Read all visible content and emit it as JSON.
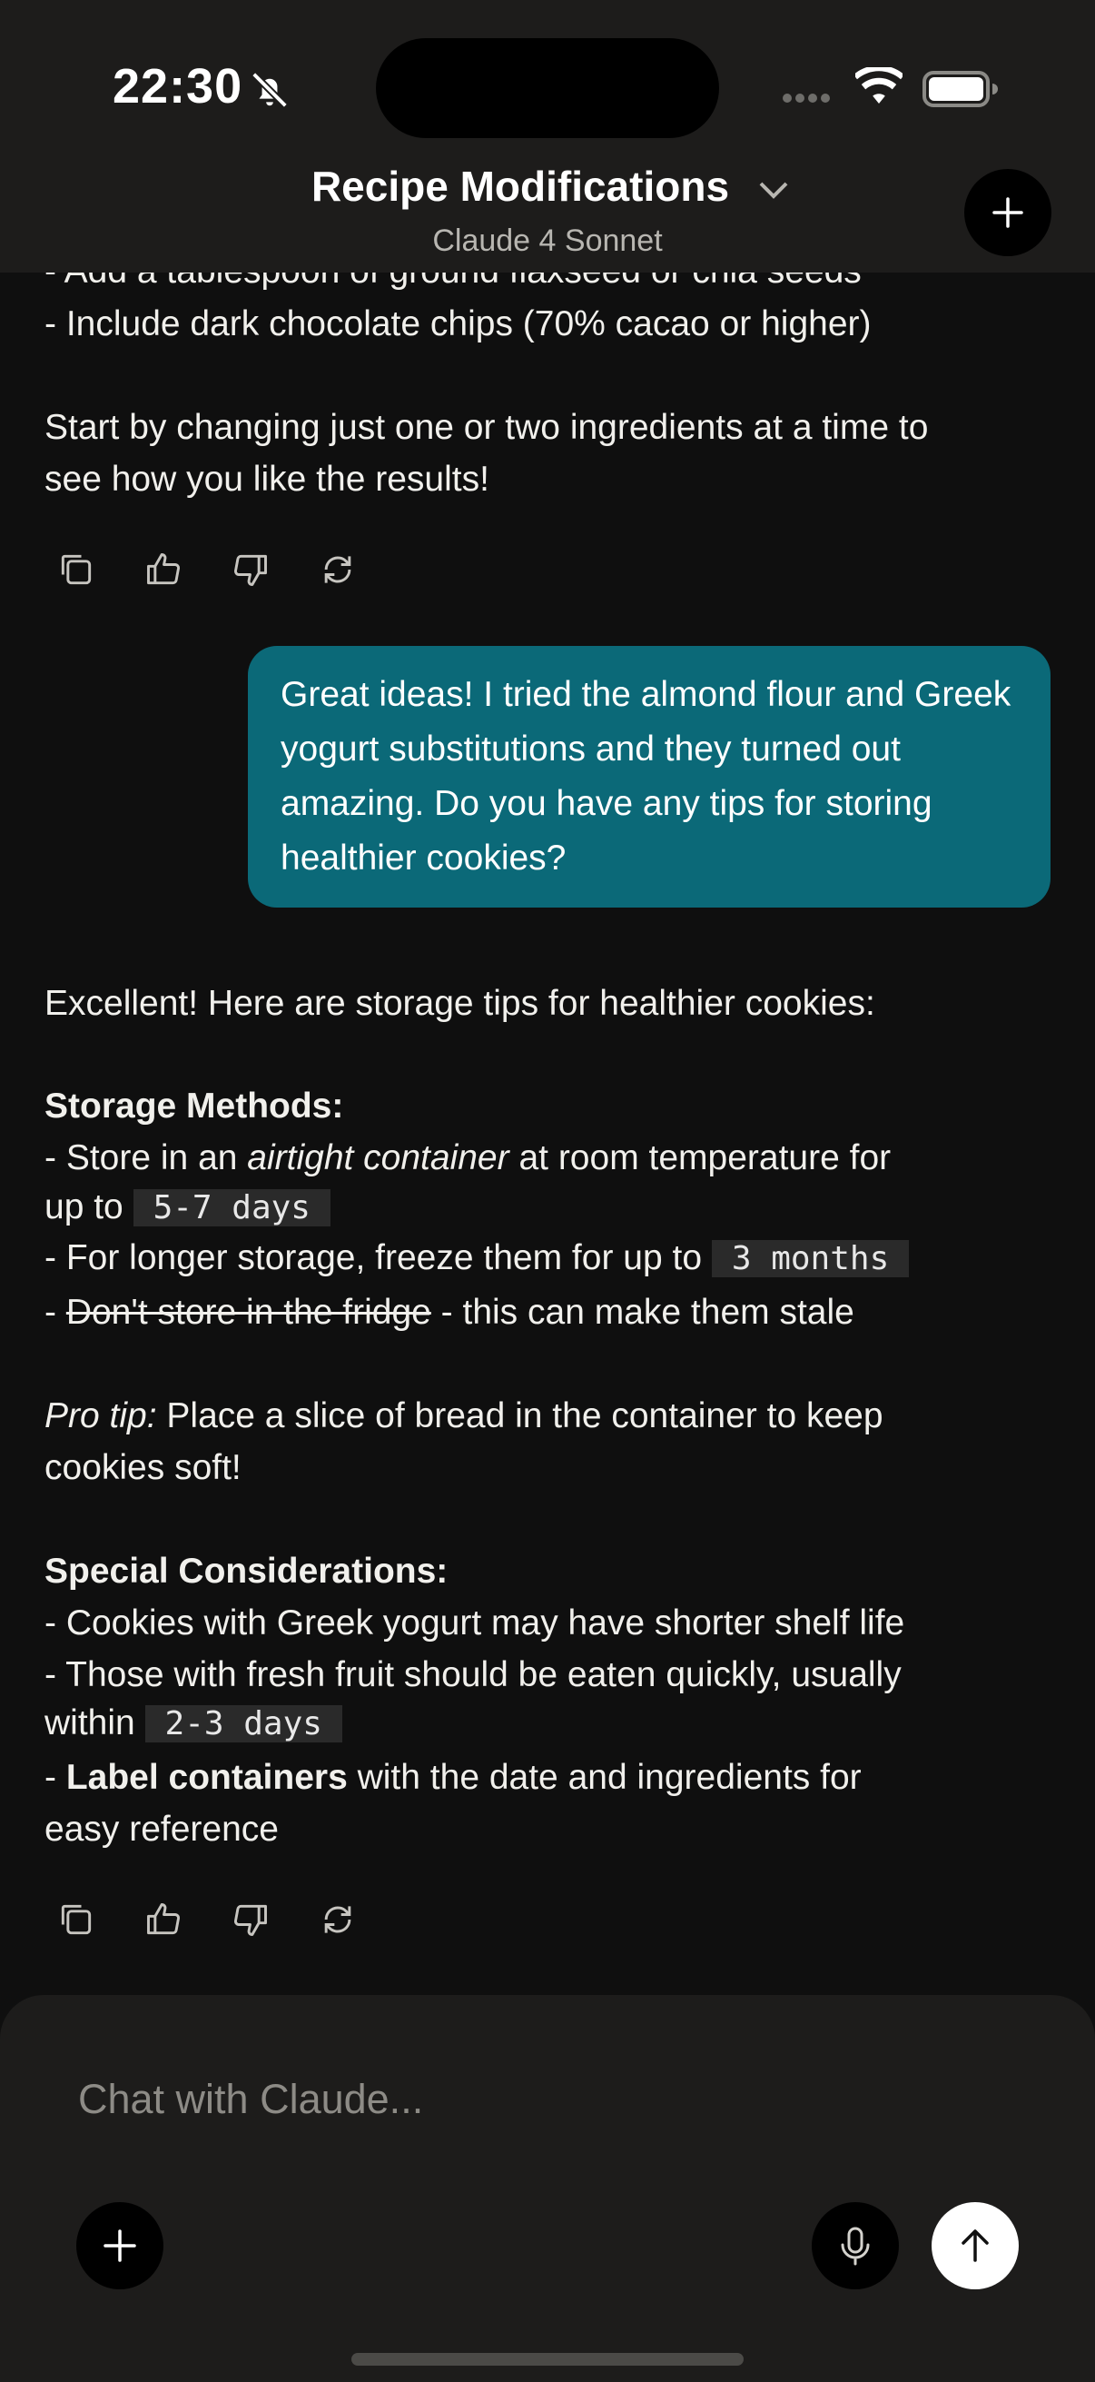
{
  "status_bar": {
    "time": "22:30"
  },
  "header": {
    "title": "Recipe Modifications",
    "model": "Claude 4 Sonnet",
    "icons": [
      "bell-slash-icon",
      "wifi-icon",
      "battery-icon",
      "chevron-down-icon",
      "plus-icon"
    ]
  },
  "prev_response": {
    "line_partial": "- Add a tablespoon of ground flaxseed or chia seeds",
    "line_chips": "- Include dark chocolate chips (70% cacao or higher)",
    "closing_1": "Start by changing just one or two ingredients at a time to",
    "closing_2": "see how you like the results!"
  },
  "user_message": {
    "text": "Great ideas! I tried the almond flour and Greek yogurt substitutions and they turned out amazing. Do you have any tips for storing healthier cookies?",
    "bubble_color": "#0b6978"
  },
  "response": {
    "intro": "Excellent! Here are storage tips for healthier cookies:",
    "storage_heading": "Storage Methods:",
    "s1_a": "- Store in an ",
    "s1_b": "airtight container",
    "s1_c": " at room temperature for",
    "s1_d": "up to ",
    "s1_code": "5-7 days",
    "s2_a": "- For longer storage, freeze them for up to ",
    "s2_code": "3 months",
    "s3_a": "- ",
    "s3_strike": "Don't store in the fridge",
    "s3_b": " - this can make them stale",
    "pro_label": "Pro tip:",
    "pro_a": " Place a slice of bread in the container to keep",
    "pro_b": "cookies soft!",
    "special_heading": "Special Considerations:",
    "c1": "- Cookies with Greek yogurt may have shorter shelf life",
    "c2_a": "- Those with fresh fruit should be eaten quickly, usually",
    "c2_b": "within ",
    "c2_code": "2-3 days",
    "c3_a": "- ",
    "c3_bold": "Label containers",
    "c3_b": " with the date and ingredients for",
    "c3_c": "easy reference"
  },
  "message_actions": [
    "copy-icon",
    "thumbs-up-icon",
    "thumbs-down-icon",
    "retry-icon"
  ],
  "composer": {
    "placeholder": "Chat with Claude..."
  }
}
